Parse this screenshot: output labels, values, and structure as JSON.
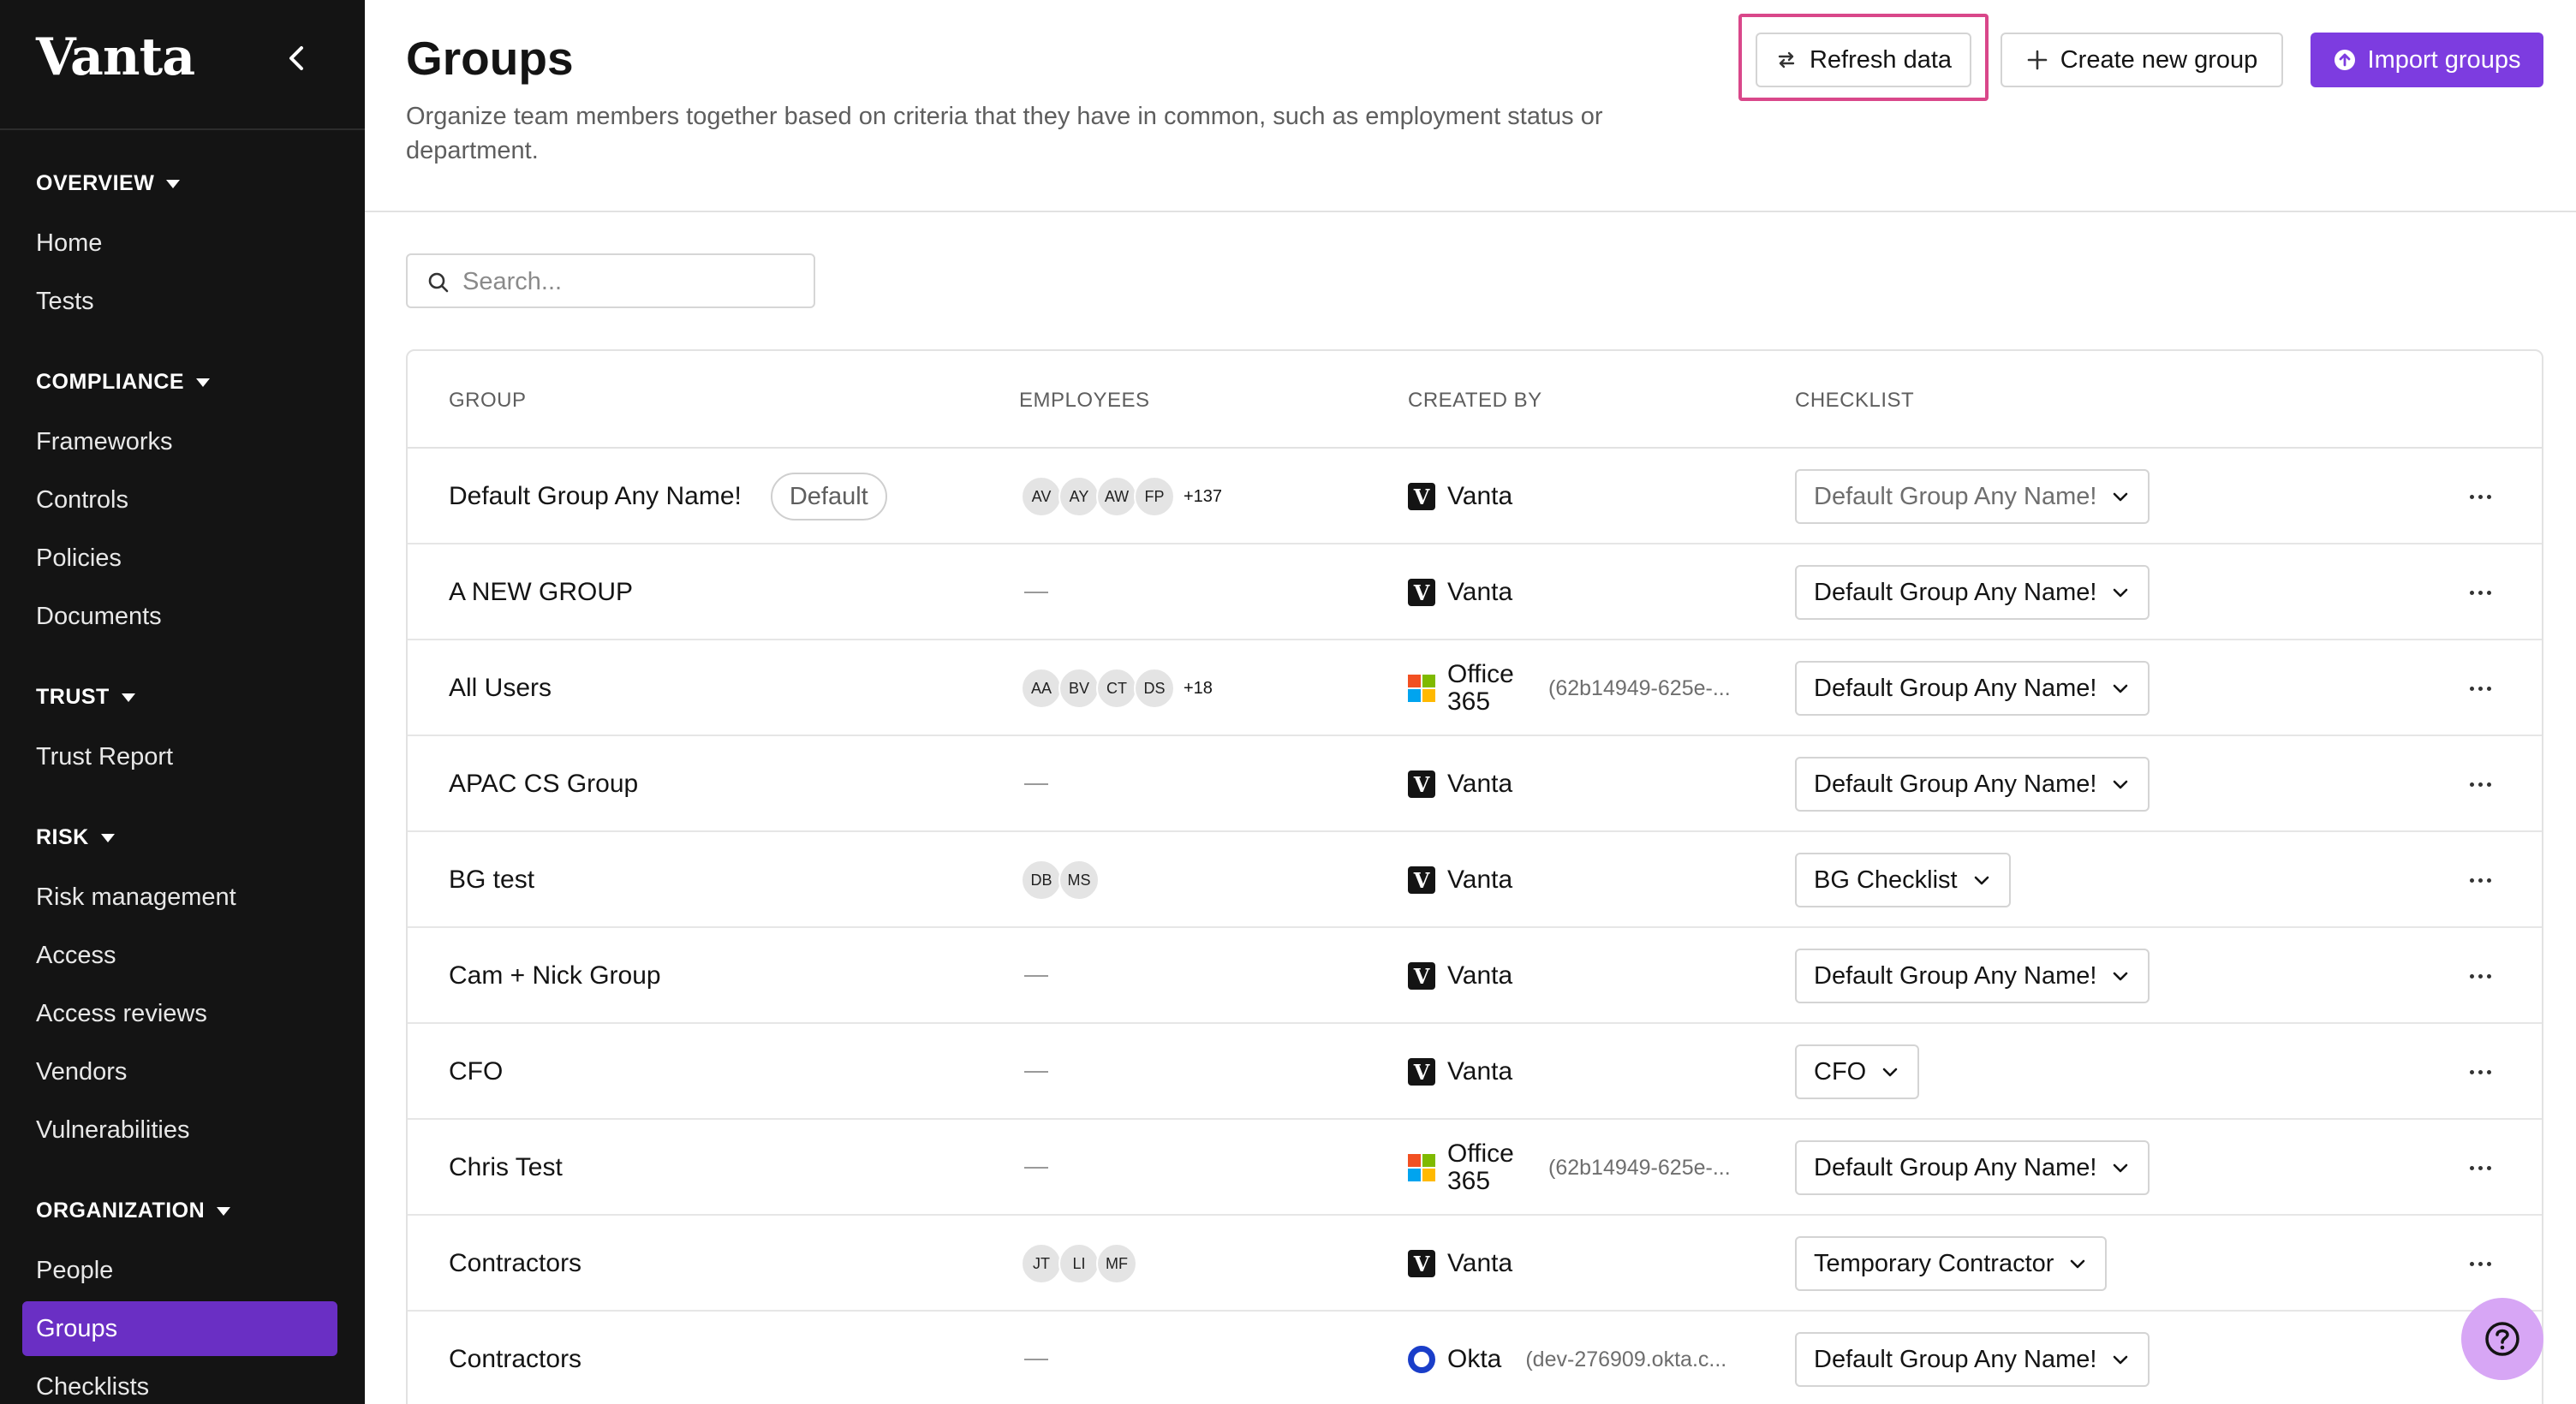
{
  "sidebar": {
    "brand": "Vanta",
    "sections": [
      {
        "title": "OVERVIEW",
        "items": [
          "Home",
          "Tests"
        ]
      },
      {
        "title": "COMPLIANCE",
        "items": [
          "Frameworks",
          "Controls",
          "Policies",
          "Documents"
        ]
      },
      {
        "title": "TRUST",
        "items": [
          "Trust Report"
        ]
      },
      {
        "title": "RISK",
        "items": [
          "Risk management",
          "Access",
          "Access reviews",
          "Vendors",
          "Vulnerabilities"
        ]
      },
      {
        "title": "ORGANIZATION",
        "items": [
          "People",
          "Groups",
          "Checklists"
        ]
      }
    ],
    "active_item": "Groups"
  },
  "header": {
    "title": "Groups",
    "description": "Organize team members together based on criteria that they have in common, such as employment status or department.",
    "refresh_label": "Refresh data",
    "create_label": "Create new group",
    "import_label": "Import groups"
  },
  "search": {
    "placeholder": "Search..."
  },
  "table": {
    "columns": [
      "GROUP",
      "EMPLOYEES",
      "CREATED BY",
      "CHECKLIST"
    ],
    "rows": [
      {
        "group": "Default Group Any Name!",
        "badge": "Default",
        "avatars": [
          "AV",
          "AY",
          "AW",
          "FP"
        ],
        "more": "+137",
        "creator": "Vanta",
        "creator_sub": "",
        "checklist": "Default Group Any Name!"
      },
      {
        "group": "A NEW GROUP",
        "badge": "",
        "avatars": [],
        "more": "",
        "creator": "Vanta",
        "creator_sub": "",
        "checklist": "Default Group Any Name!"
      },
      {
        "group": "All Users",
        "badge": "",
        "avatars": [
          "AA",
          "BV",
          "CT",
          "DS"
        ],
        "more": "+18",
        "creator": "Office 365",
        "creator_sub": "(62b14949-625e-...",
        "checklist": "Default Group Any Name!"
      },
      {
        "group": "APAC CS Group",
        "badge": "",
        "avatars": [],
        "more": "",
        "creator": "Vanta",
        "creator_sub": "",
        "checklist": "Default Group Any Name!"
      },
      {
        "group": "BG test",
        "badge": "",
        "avatars": [
          "DB",
          "MS"
        ],
        "more": "",
        "creator": "Vanta",
        "creator_sub": "",
        "checklist": "BG Checklist"
      },
      {
        "group": "Cam + Nick Group",
        "badge": "",
        "avatars": [],
        "more": "",
        "creator": "Vanta",
        "creator_sub": "",
        "checklist": "Default Group Any Name!"
      },
      {
        "group": "CFO",
        "badge": "",
        "avatars": [],
        "more": "",
        "creator": "Vanta",
        "creator_sub": "",
        "checklist": "CFO"
      },
      {
        "group": "Chris Test",
        "badge": "",
        "avatars": [],
        "more": "",
        "creator": "Office 365",
        "creator_sub": "(62b14949-625e-...",
        "checklist": "Default Group Any Name!"
      },
      {
        "group": "Contractors",
        "badge": "",
        "avatars": [
          "JT",
          "LI",
          "MF"
        ],
        "more": "",
        "creator": "Vanta",
        "creator_sub": "",
        "checklist": "Temporary Contractor"
      },
      {
        "group": "Contractors",
        "badge": "",
        "avatars": [],
        "more": "",
        "creator": "Okta",
        "creator_sub": "(dev-276909.okta.c...",
        "checklist": "Default Group Any Name!"
      }
    ]
  },
  "colors": {
    "accent": "#7d3ce0",
    "sidebar_bg": "#141414",
    "active_nav": "#6a2fc4",
    "highlight": "#d9478a",
    "help_bg": "#d7a6f5"
  },
  "icons": [
    "chevron-left-icon",
    "caret-down-icon",
    "refresh-icon",
    "plus-icon",
    "import-icon",
    "search-icon",
    "vanta-logo-icon",
    "office365-logo-icon",
    "okta-logo-icon",
    "chevron-down-icon",
    "more-icon",
    "help-icon"
  ]
}
